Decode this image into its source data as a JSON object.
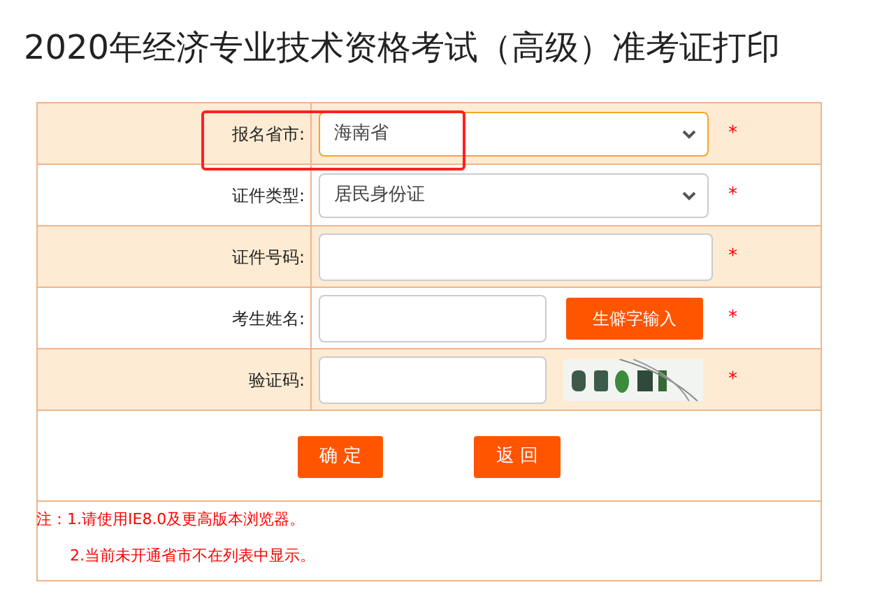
{
  "title": "2020年经济专业技术资格考试（高级）准考证打印",
  "rows": [
    {
      "kind": "select",
      "label": "报名省市:",
      "value": "海南省",
      "highlighted": true,
      "required": "*"
    },
    {
      "kind": "select",
      "label": "证件类型:",
      "value": "居民身份证",
      "highlighted": false,
      "required": "*"
    },
    {
      "kind": "input",
      "label": "证件号码:",
      "required": "*"
    },
    {
      "kind": "input_button",
      "label": "考生姓名:",
      "button": "生僻字输入",
      "required": "*"
    },
    {
      "kind": "captcha",
      "label": "验证码:",
      "required": "*"
    }
  ],
  "buttons": [
    "确 定",
    "返 回"
  ],
  "notes": [
    "注：1.请使用IE8.0及更高版本浏览器。",
    "2.当前未开通省市不在列表中显示。"
  ]
}
